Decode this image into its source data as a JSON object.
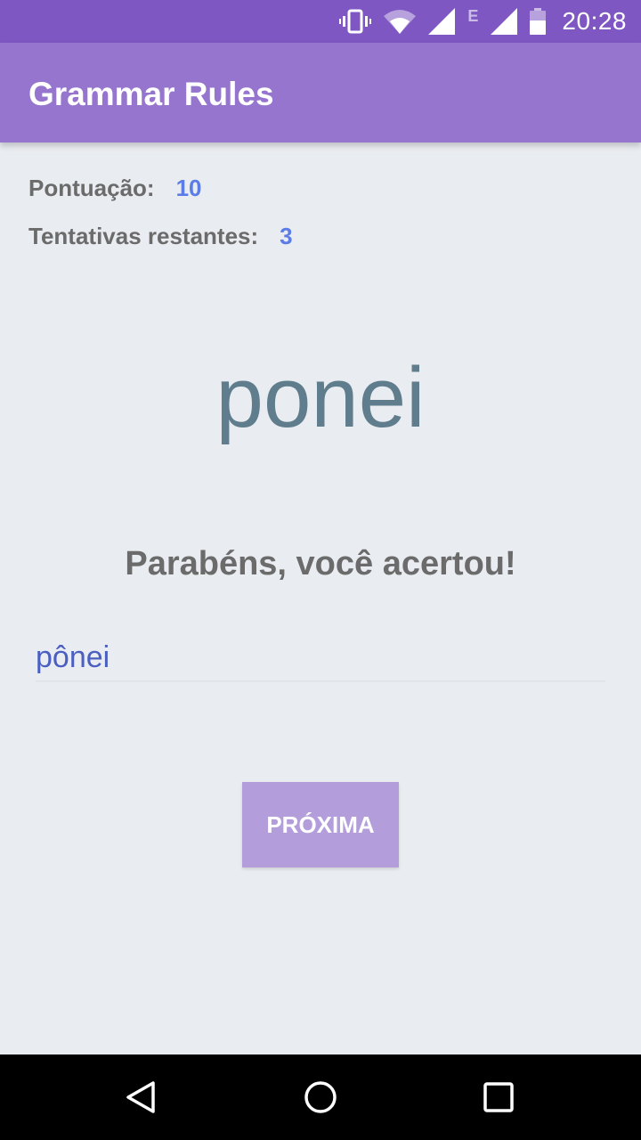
{
  "status_bar": {
    "time": "20:28",
    "network_label": "E",
    "icons": [
      "vibrate-icon",
      "wifi-icon",
      "signal-icon",
      "signal-icon",
      "battery-icon"
    ],
    "color": "#7E57C2"
  },
  "app_bar": {
    "title": "Grammar Rules",
    "color": "#9575CD"
  },
  "stats": {
    "score_label": "Pontuação:",
    "score_value": "10",
    "attempts_label": "Tentativas restantes:",
    "attempts_value": "3"
  },
  "game": {
    "word": "ponei",
    "feedback": "Parabéns, você acertou!",
    "answer_value": "pônei",
    "next_label": "PRÓXIMA"
  },
  "nav_bar": {
    "icons": [
      "back-icon",
      "home-icon",
      "recent-apps-icon"
    ]
  }
}
